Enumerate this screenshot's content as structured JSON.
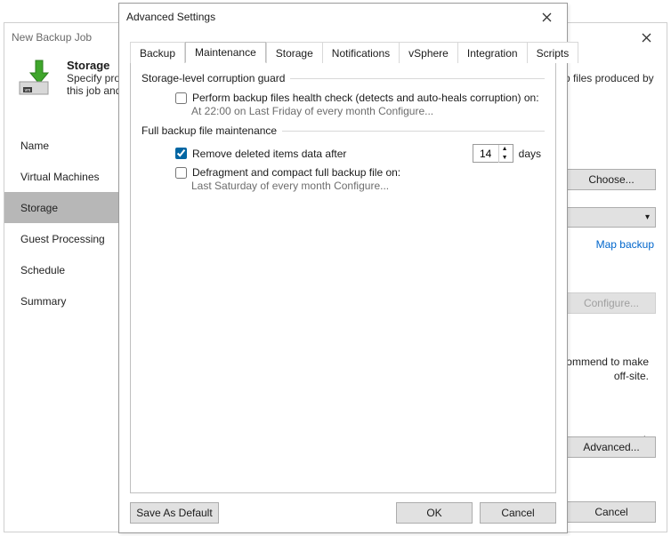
{
  "back": {
    "title": "New Backup Job",
    "header_title": "Storage",
    "header_desc": "Specify processing proxy server to be used for source data retrieval, backup repository to store the backup files produced by this job and customize advanced job settings if required.",
    "sidebar": [
      "Name",
      "Virtual Machines",
      "Storage",
      "Guest Processing",
      "Schedule",
      "Summary"
    ],
    "choose": "Choose...",
    "configure": "Configure...",
    "map_backup": "Map backup",
    "advanced": "Advanced...",
    "recommend": "recommend to make",
    "offsite": "off-site.",
    "ck": "ck",
    "footer_cancel": "Cancel"
  },
  "dlg": {
    "title": "Advanced Settings",
    "tabs": [
      "Backup",
      "Maintenance",
      "Storage",
      "Notifications",
      "vSphere",
      "Integration",
      "Scripts"
    ],
    "group1_title": "Storage-level corruption guard",
    "chk1_label": "Perform backup files health check (detects and auto-heals corruption) on:",
    "chk1_sub": "At 22:00 on Last Friday of every month  Configure...",
    "group2_title": "Full backup file maintenance",
    "chk2_label": "Remove deleted items data after",
    "days_value": "14",
    "days_label": "days",
    "chk3_label": "Defragment and compact full backup file on:",
    "chk3_sub": "Last Saturday of every month  Configure...",
    "save_default": "Save As Default",
    "ok": "OK",
    "cancel": "Cancel"
  }
}
